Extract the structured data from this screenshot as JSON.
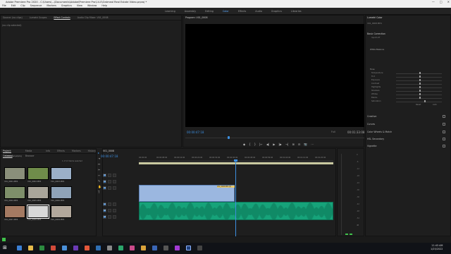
{
  "window": {
    "title": "Adobe Premiere Pro 2020 - C:\\Users\\...\\Documents\\Adobe\\Premiere Pro\\14.0\\Oatmeal Real Estate Video.prproj *",
    "controls": [
      "—",
      "□",
      "✕"
    ]
  },
  "menu": [
    "File",
    "Edit",
    "Clip",
    "Sequence",
    "Markers",
    "Graphics",
    "View",
    "Window",
    "Help"
  ],
  "workspaces": {
    "items": [
      "Learning",
      "Assembly",
      "Editing",
      "Color",
      "Effects",
      "Audio",
      "Graphics",
      "Libraries"
    ],
    "active": "Color"
  },
  "source_panel": {
    "tabs": [
      "Source: (no clips)",
      "Lumetri Scopes",
      "Effect Controls",
      "Audio Clip Mixer: V01_0008"
    ],
    "active_tab": "Effect Controls",
    "message": "(no clip selected)"
  },
  "program_panel": {
    "title": "Program: V01_0008",
    "timecode": "00:00:47:18",
    "fit": "Full",
    "duration": "00:01:33:08",
    "controls": [
      "◆",
      "{",
      "}",
      "|←",
      "◀|",
      "▶",
      "|▶",
      "→|",
      "⊞",
      "⊟",
      "📷",
      "⋯"
    ]
  },
  "lumetri": {
    "title": "Lumetri Color",
    "clip": "V01_0008.MP4",
    "sections": [
      "Basic Correction",
      "Creative",
      "Curves",
      "Color Wheels & Match",
      "HSL Secondary",
      "Vignette"
    ],
    "basic": {
      "input_lut": "Input LUT",
      "white_balance": "White Balance",
      "tone": "Tone",
      "rows": [
        "Temperature",
        "Tint",
        "Exposure",
        "Contrast",
        "Highlights",
        "Shadows",
        "Whites",
        "Blacks",
        "Saturation"
      ],
      "levels": [
        0.5,
        0.5,
        0.5,
        0.5,
        0.5,
        0.5,
        0.5,
        0.5,
        0.62
      ],
      "reset": "Reset",
      "auto": "Auto"
    }
  },
  "project_panel": {
    "tabs": [
      "Project: Oatmeal",
      "Media Browser",
      "Info",
      "Effects",
      "Markers",
      "History"
    ],
    "active_tab": "Project: Oatmeal",
    "bin": "Oatmeal.prproj",
    "count": "1 of 13 items selected",
    "clips": [
      {
        "name": "V01_0001.MP4",
        "dur": "13:15",
        "color": "#8a8f7a"
      },
      {
        "name": "V01_0002.MP4",
        "dur": "10:02",
        "color": "#6f8c4a"
      },
      {
        "name": "V01_0003.MP4",
        "dur": "8:12",
        "color": "#9bb0c8"
      },
      {
        "name": "V01_0004.MP4",
        "dur": "12:06",
        "color": "#7e8f6a"
      },
      {
        "name": "V01_0005.MP4",
        "dur": "9:20",
        "color": "#a9a59a"
      },
      {
        "name": "V01_0006.MP4",
        "dur": "11:01",
        "color": "#8fa3b8"
      },
      {
        "name": "V01_0007.MP4",
        "dur": "7:14",
        "color": "#a47a62"
      },
      {
        "name": "V01_0008.MP4",
        "dur": "15:22",
        "color": "#d8d8d8"
      },
      {
        "name": "V01_0009.MP4",
        "dur": "6:18",
        "color": "#b2a89c"
      }
    ]
  },
  "timeline": {
    "sequence": "V01_0008",
    "timecode": "00:00:47:18",
    "ticks": [
      "00:00:00",
      "00:00:08:00",
      "00:00:16:00",
      "00:00:24:00",
      "00:00:32:00",
      "00:00:40:00",
      "00:00:48:00",
      "00:00:56:00",
      "00:01:04:00",
      "00:01:12:00",
      "00:01:20:00"
    ],
    "video_tracks": [
      "V3",
      "V2",
      "V1"
    ],
    "audio_tracks": [
      "A1",
      "A2",
      "A3"
    ],
    "video_clip": "V01_0008.MP4 [V]",
    "audio_clip": "V01_0008.MP4",
    "playhead": 0.495
  },
  "meter": {
    "scale": [
      "0",
      "-6",
      "-12",
      "-18",
      "-24",
      "-30",
      "-36",
      "-42",
      "-48",
      "-54",
      "dB"
    ],
    "levels": [
      0.02,
      0.02
    ]
  },
  "taskbar": {
    "time": "11:43 AM",
    "date": "1/25/2022"
  },
  "colors": {
    "accent": "#3d8fe0",
    "audio": "#16a37a",
    "video": "#9bb7e0"
  }
}
